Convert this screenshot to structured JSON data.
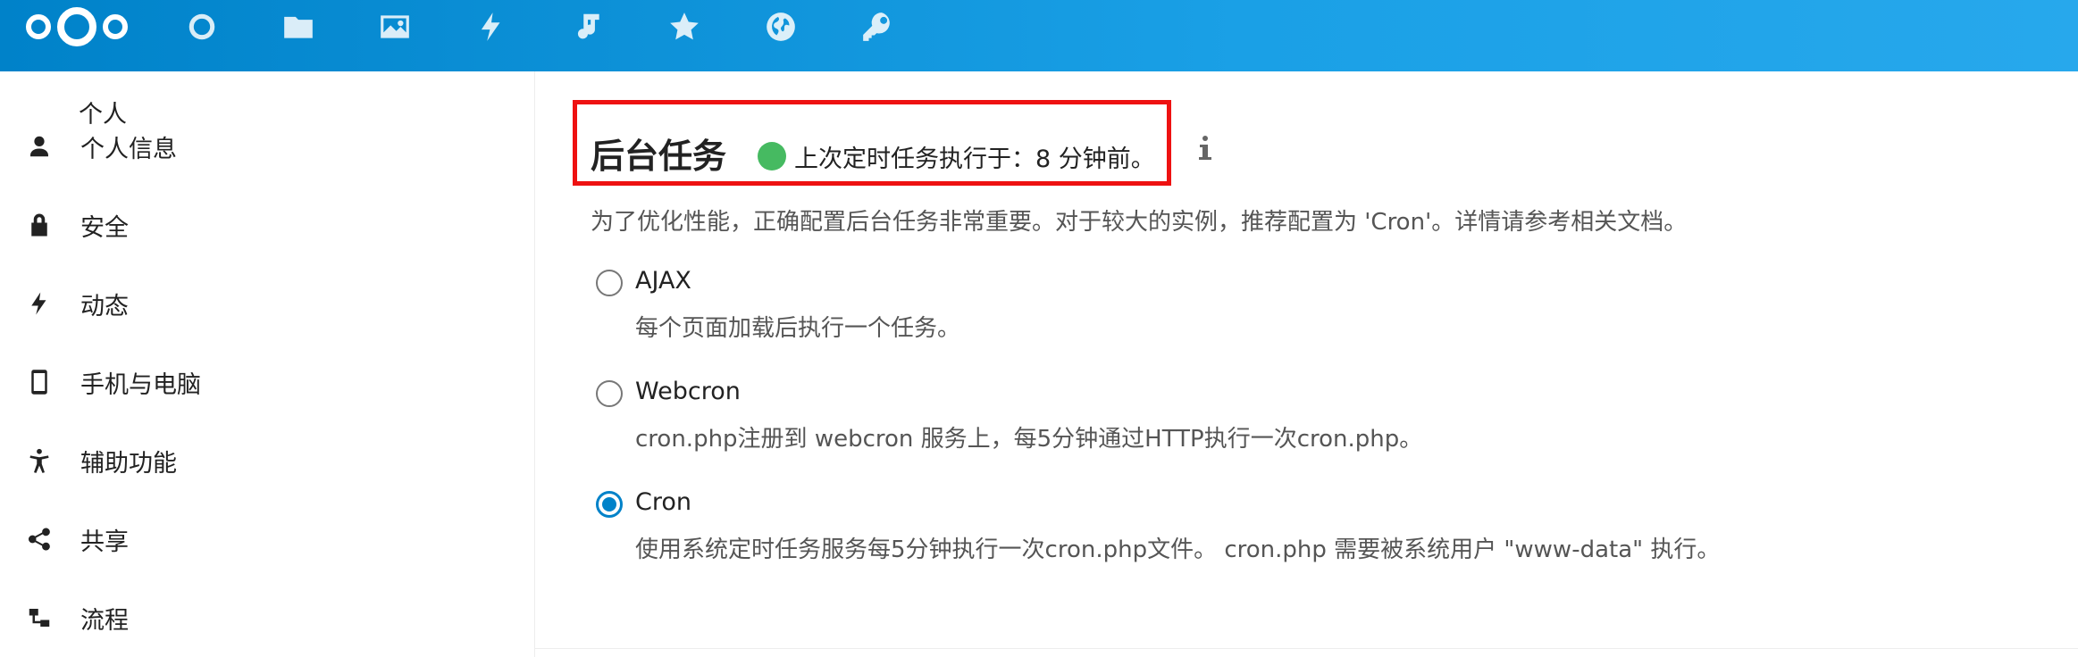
{
  "topbar": {
    "apps": [
      {
        "name": "dashboard",
        "icon": "circle-icon"
      },
      {
        "name": "files",
        "icon": "folder-icon"
      },
      {
        "name": "photos",
        "icon": "image-icon"
      },
      {
        "name": "activity",
        "icon": "lightning-icon"
      },
      {
        "name": "music",
        "icon": "music-note-icon"
      },
      {
        "name": "favorites",
        "icon": "star-icon"
      },
      {
        "name": "web",
        "icon": "globe-icon"
      },
      {
        "name": "passwords",
        "icon": "key-icon"
      }
    ]
  },
  "sidebar": {
    "heading": "个人",
    "items": [
      {
        "label": "个人信息",
        "icon": "user-icon"
      },
      {
        "label": "安全",
        "icon": "lock-icon"
      },
      {
        "label": "动态",
        "icon": "lightning-icon"
      },
      {
        "label": "手机与电脑",
        "icon": "phone-icon"
      },
      {
        "label": "辅助功能",
        "icon": "accessibility-icon"
      },
      {
        "label": "共享",
        "icon": "share-icon"
      },
      {
        "label": "流程",
        "icon": "flow-icon"
      }
    ]
  },
  "main": {
    "title": "后台任务",
    "status": "上次定时任务执行于：8 分钟前。",
    "status_color": "#46ba61",
    "description": "为了优化性能，正确配置后台任务非常重要。对于较大的实例，推荐配置为 'Cron'。详情请参考相关文档。",
    "options": [
      {
        "label": "AJAX",
        "description": "每个页面加载后执行一个任务。",
        "checked": false
      },
      {
        "label": "Webcron",
        "description": "cron.php注册到 webcron 服务上，每5分钟通过HTTP执行一次cron.php。",
        "checked": false
      },
      {
        "label": "Cron",
        "description": "使用系统定时任务服务每5分钟执行一次cron.php文件。 cron.php 需要被系统用户 \"www-data\" 执行。",
        "checked": true
      }
    ]
  },
  "colors": {
    "header_start": "#0082c9",
    "header_end": "#27a8ec",
    "accent": "#0082c9",
    "highlight_border": "#ee1111"
  }
}
